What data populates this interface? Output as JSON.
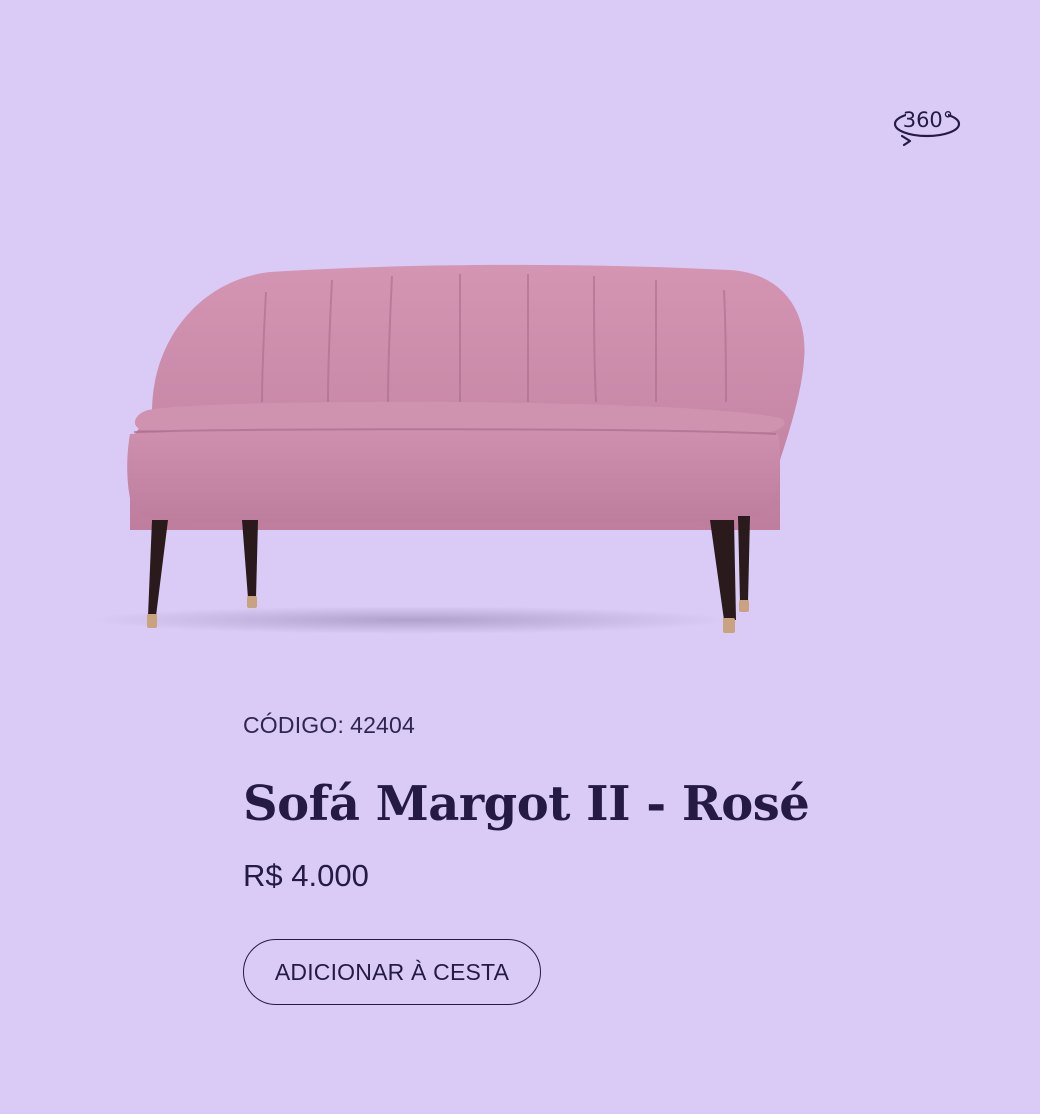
{
  "product": {
    "code_label": "CÓDIGO:",
    "code_value": "42404",
    "name": "Sofá Margot II - Rosé",
    "price": "R$ 4.000",
    "add_to_cart_label": "ADICIONAR À CESTA",
    "viewer_label": "360°"
  },
  "icons": {
    "viewer": "360-view-icon"
  },
  "colors": {
    "background": "#d9cbf6",
    "text": "#241a44",
    "sofa_fabric": "#c98aa8",
    "sofa_legs": "#2a1a1c",
    "leg_caps": "#c9a27f"
  }
}
